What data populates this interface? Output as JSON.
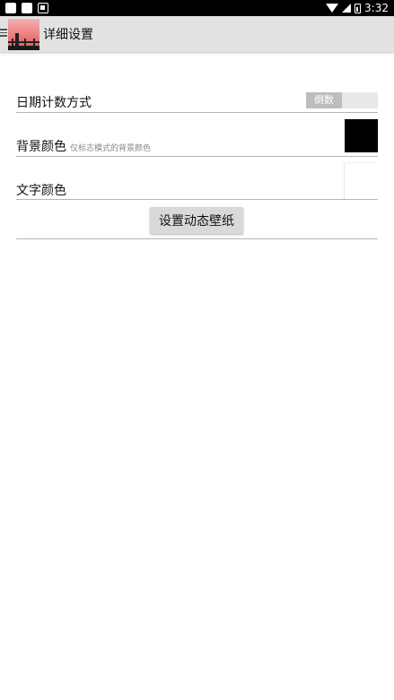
{
  "status_bar": {
    "time": "3:32"
  },
  "app_bar": {
    "title": "详细设置"
  },
  "settings": {
    "date_mode": {
      "label": "日期计数方式",
      "toggle_text": "倒数"
    },
    "background_color": {
      "label": "背景颜色",
      "sublabel": "仅标志模式的背景颜色",
      "value_color": "#000000"
    },
    "text_color": {
      "label": "文字颜色",
      "value_color": "#ffffff"
    }
  },
  "actions": {
    "set_wallpaper_label": "设置动态壁纸"
  }
}
